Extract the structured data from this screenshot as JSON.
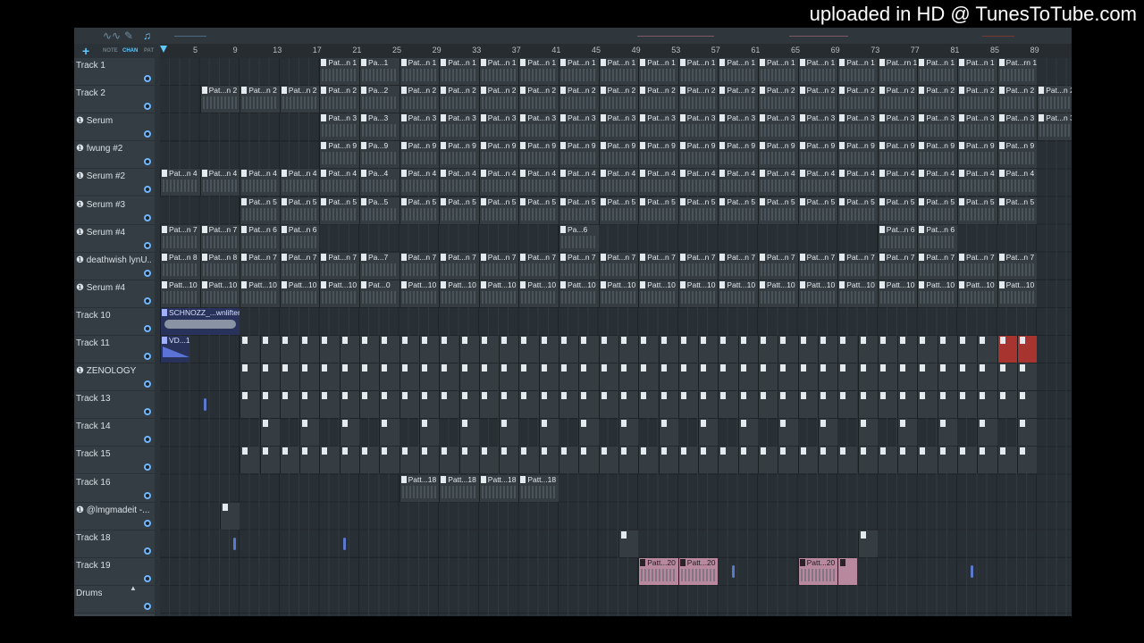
{
  "watermark": "uploaded in HD @ TunesToTube.com",
  "toolbar": {
    "icons": [
      "waveform-icon",
      "pencil-icon",
      "piano-icon"
    ],
    "add_symbol": "+",
    "modes": [
      "NOTE",
      "CHAN",
      "PAT"
    ],
    "active_mode": "CHAN"
  },
  "ruler": {
    "bar_numbers": [
      "5",
      "9",
      "13",
      "17",
      "21",
      "25",
      "29",
      "33",
      "37",
      "41",
      "45",
      "49",
      "53",
      "57",
      "61",
      "65",
      "69",
      "73",
      "77",
      "81",
      "85",
      "89"
    ]
  },
  "tracks": [
    {
      "name": "Track 1",
      "has_icon": false
    },
    {
      "name": "Track 2",
      "has_icon": false
    },
    {
      "name": "Serum",
      "has_icon": true
    },
    {
      "name": "fwung #2",
      "has_icon": true
    },
    {
      "name": "Serum #2",
      "has_icon": true
    },
    {
      "name": "Serum #3",
      "has_icon": true
    },
    {
      "name": "Serum #4",
      "has_icon": true
    },
    {
      "name": "deathwish lynU...",
      "has_icon": true
    },
    {
      "name": "Serum #4",
      "has_icon": true
    },
    {
      "name": "Track 10",
      "has_icon": false
    },
    {
      "name": "Track 11",
      "has_icon": false
    },
    {
      "name": "ZENOLOGY",
      "has_icon": true
    },
    {
      "name": "Track 13",
      "has_icon": false
    },
    {
      "name": "Track 14",
      "has_icon": false
    },
    {
      "name": "Track 15",
      "has_icon": false
    },
    {
      "name": "Track 16",
      "has_icon": false
    },
    {
      "name": "@lmgmadeit -...",
      "has_icon": true
    },
    {
      "name": "Track 18",
      "has_icon": false
    },
    {
      "name": "Track 19",
      "has_icon": false
    },
    {
      "name": "Drums",
      "has_icon": false
    }
  ],
  "clip_labels": {
    "track1": "Pat...n 1",
    "track1_short": "Pa...1",
    "track1_alt": "Pat...rn 1",
    "track2": "Pat...n 2",
    "track2_short": "Pa...2",
    "track3": "Pat...n 3",
    "track3_short": "Pa...3",
    "track4": "Pat...n 9",
    "track4_short": "Pa...9",
    "track5": "Pat...n 4",
    "track5_short": "Pa...4",
    "track6": "Pat...n 5",
    "track6_short": "Pa...5",
    "track7a": "Pat...n 7",
    "track7b": "Pat...n 6",
    "track7c": "Pa...6",
    "track8a": "Pat...n 8",
    "track8b": "Pat...n 7",
    "track8_short": "Pa...7",
    "track9": "Patt...10",
    "track9_short": "Pat...0",
    "track10": "SCHNOZZ_...wnlifter",
    "track11": "VD...1",
    "track16": "Patt...18",
    "track19": "Patt...20"
  },
  "colors": {
    "accent": "#5ec8ff",
    "pink_clip": "#b8889e",
    "red_clip": "#a8342f",
    "blue_clip": "#28325a"
  }
}
